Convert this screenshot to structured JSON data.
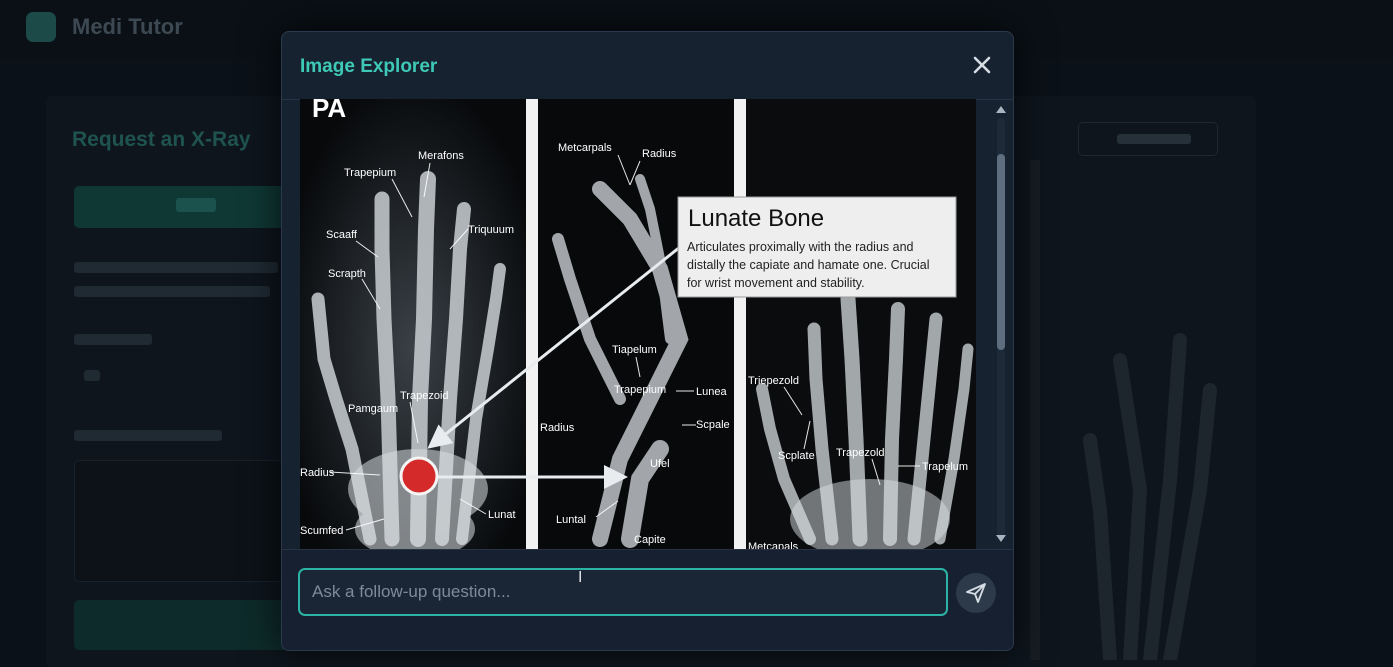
{
  "background": {
    "brand": "Medi Tutor",
    "title": "Request an X-Ray"
  },
  "modal": {
    "title": "Image Explorer",
    "close_icon": "close-icon",
    "accent_color": "#3ec9b7"
  },
  "xray": {
    "view_label": "PA",
    "panel1_labels": [
      "Merafons",
      "Trapepium",
      "Scaaff",
      "Triquuum",
      "Scrapth",
      "Trapezoid",
      "Pamgaum",
      "Radius",
      "Lunat",
      "Scumfed"
    ],
    "panel2_labels": [
      "Metcarpals",
      "Radius",
      "Tiapelum",
      "Trapepium",
      "Lunea",
      "Radius",
      "Scpale",
      "Ufel",
      "Luntal",
      "Capite"
    ],
    "panel3_labels": [
      "Triepezold",
      "Scplate",
      "Trapezold",
      "Trapelum",
      "Metcapals"
    ],
    "callout": {
      "title": "Lunate Bone",
      "line1": "Articulates proximally with the radius and",
      "line2": "distally the capiate and hamate one. Crucial",
      "line3": "for wrist movement and stability."
    },
    "highlight_color": "#d42a2a"
  },
  "followup": {
    "placeholder": "Ask a follow-up question...",
    "value": "",
    "send_icon": "send-icon"
  }
}
